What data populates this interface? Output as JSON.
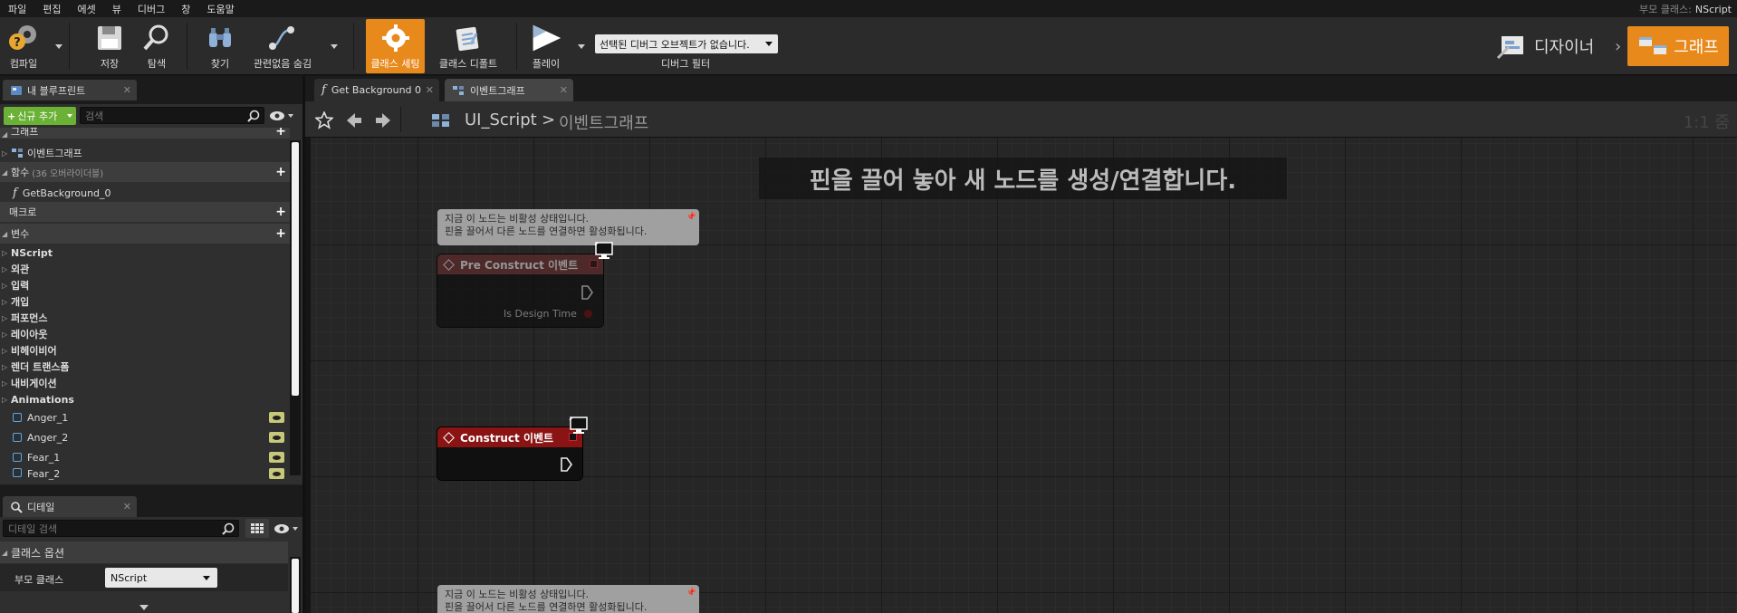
{
  "menu": [
    "파일",
    "편집",
    "에셋",
    "뷰",
    "디버그",
    "창",
    "도움말"
  ],
  "parent_class": {
    "label": "부모 클래스:",
    "value": "NScript"
  },
  "toolbar": {
    "compile": "컴파일",
    "save": "저장",
    "browse": "탐색",
    "find": "찾기",
    "hide_unrelated": "관련없음 숨김",
    "class_settings": "클래스 세팅",
    "class_defaults": "클래스 디폴트",
    "play": "플레이",
    "debug_object": "선택된 디버그 오브젝트가 없습니다.",
    "debug_filter": "디버그 필터"
  },
  "modes": {
    "designer": "디자이너",
    "graph": "그래프"
  },
  "my_blueprint": {
    "tab": "내 블루프린트",
    "add_new": "신규 추가",
    "search_placeholder": "검색",
    "graphs_header": "그래프",
    "event_graph": "이벤트그래프",
    "functions_header": "함수",
    "functions_override": "(36 오버라이더블)",
    "function_item": "GetBackground_0",
    "macros_header": "매크로",
    "variables_header": "변수",
    "categories": [
      "NScript",
      "외관",
      "입력",
      "개입",
      "퍼포먼스",
      "레이아웃",
      "비헤이비어",
      "렌더 트랜스폼",
      "내비게이션",
      "Animations"
    ],
    "anim_vars": [
      "Anger_1",
      "Anger_2",
      "Fear_1",
      "Fear_2"
    ]
  },
  "details": {
    "tab": "디테일",
    "search_placeholder": "디테일 검색",
    "section": "클래스 옵션",
    "parent_class_label": "부모 클래스",
    "parent_class_value": "NScript"
  },
  "doc_tabs": [
    "Get Background 0",
    "이벤트그래프"
  ],
  "breadcrumb": {
    "root": "UI_Script",
    "sep": ">",
    "current": "이벤트그래프"
  },
  "zoom": "1:1 줌",
  "hint": "핀을 끌어 놓아 새 노드를 생성/연결합니다.",
  "inactive_note": {
    "line1": "지금 이 노드는 비활성 상태입니다.",
    "line2": "핀을 끌어서 다른 노드를 연결하면 활성화됩니다."
  },
  "nodes": {
    "pre_construct": {
      "title": "Pre Construct 이벤트",
      "pin_label": "Is Design Time"
    },
    "construct": {
      "title": "Construct 이벤트"
    }
  },
  "colors": {
    "accent": "#e8891c",
    "add_green": "#6ab136",
    "node_red": "#8a1414"
  }
}
